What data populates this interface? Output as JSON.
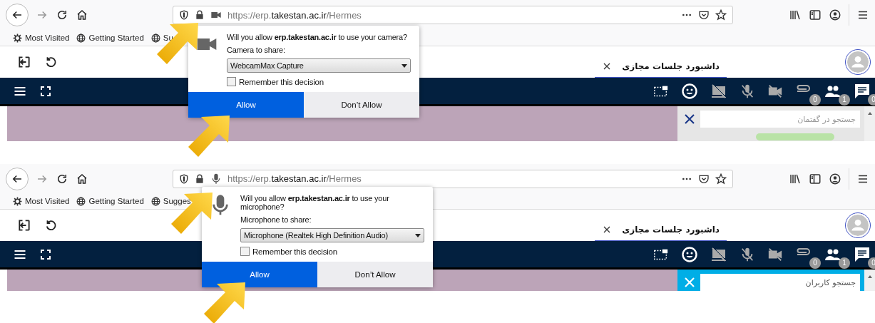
{
  "panels": [
    {
      "kind": "camera",
      "url": {
        "scheme": "https://erp.",
        "domain": "takestan.ac.ir",
        "path": "/Hermes"
      },
      "bookmarks": [
        {
          "kind": "gear",
          "label": "Most Visited"
        },
        {
          "kind": "globe",
          "label": "Getting Started"
        },
        {
          "kind": "globe",
          "label": "Su"
        }
      ],
      "popup": {
        "question": "Will you allow **erp.takestan.ac.ir** to use your camera?",
        "share_label": "Camera to share:",
        "device": "WebcamMax Capture",
        "remember": {
          "label": "Remember this decision",
          "checked": false
        },
        "allow": "Allow",
        "deny": "Don’t Allow"
      },
      "tab": {
        "label": "داشبورد جلسات مجازی",
        "selected": true
      },
      "badges": {
        "attachments": "0",
        "participants": "1",
        "messages": "0"
      },
      "side_panel": {
        "kind": "chat",
        "placeholder": "جستجو در گفتمان"
      }
    },
    {
      "kind": "microphone",
      "url": {
        "scheme": "https://erp.",
        "domain": "takestan.ac.ir",
        "path": "/Hermes"
      },
      "bookmarks": [
        {
          "kind": "gear",
          "label": "Most Visited"
        },
        {
          "kind": "globe",
          "label": "Getting Started"
        },
        {
          "kind": "globe",
          "label": "Sugges"
        }
      ],
      "popup": {
        "question": "Will you allow **erp.takestan.ac.ir** to use your microphone?",
        "share_label": "Microphone to share:",
        "device": "Microphone (Realtek High Definition Audio)",
        "remember": {
          "label": "Remember this decision",
          "checked": false
        },
        "allow": "Allow",
        "deny": "Don’t Allow"
      },
      "tab": {
        "label": "داشبورد جلسات مجازی",
        "selected": true
      },
      "badges": {
        "attachments": "0",
        "participants": "1",
        "messages": "0"
      },
      "side_panel": {
        "kind": "users",
        "placeholder": "جستجو کاربران"
      }
    }
  ]
}
